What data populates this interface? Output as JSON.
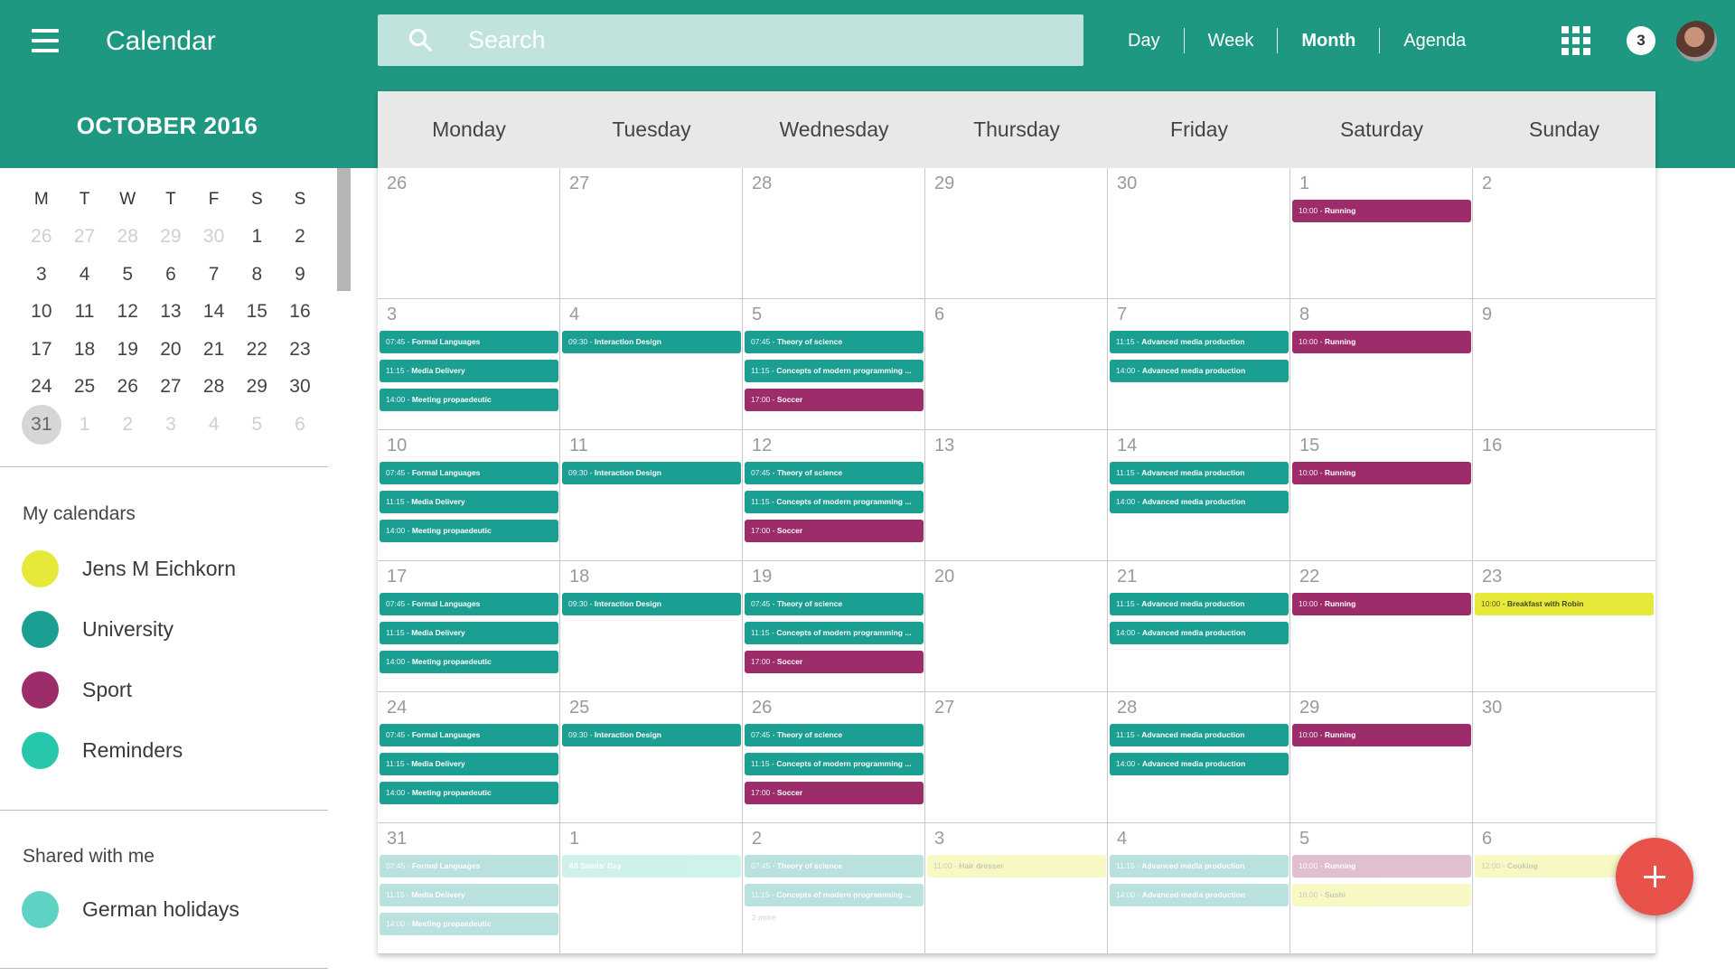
{
  "header": {
    "title": "Calendar",
    "search_placeholder": "Search",
    "views": [
      {
        "label": "Day",
        "active": false
      },
      {
        "label": "Week",
        "active": false
      },
      {
        "label": "Month",
        "active": true
      },
      {
        "label": "Agenda",
        "active": false
      }
    ],
    "notification_count": "3"
  },
  "colors": {
    "primary": "#1f9882",
    "university": "#1a9f92",
    "sport": "#9c2d6a",
    "reminders": "#27c7ab",
    "german_holidays": "#5fd3c3",
    "personal": "#e6e93a",
    "fab": "#e9524b"
  },
  "sidebar": {
    "month_label": "OCTOBER 2016",
    "mini_calendar": {
      "weekdays": [
        "M",
        "T",
        "W",
        "T",
        "F",
        "S",
        "S"
      ],
      "weeks": [
        [
          {
            "d": "26",
            "m": true
          },
          {
            "d": "27",
            "m": true
          },
          {
            "d": "28",
            "m": true
          },
          {
            "d": "29",
            "m": true
          },
          {
            "d": "30",
            "m": true
          },
          {
            "d": "1"
          },
          {
            "d": "2"
          }
        ],
        [
          {
            "d": "3"
          },
          {
            "d": "4"
          },
          {
            "d": "5"
          },
          {
            "d": "6"
          },
          {
            "d": "7"
          },
          {
            "d": "8"
          },
          {
            "d": "9"
          }
        ],
        [
          {
            "d": "10"
          },
          {
            "d": "11"
          },
          {
            "d": "12"
          },
          {
            "d": "13"
          },
          {
            "d": "14"
          },
          {
            "d": "15"
          },
          {
            "d": "16"
          }
        ],
        [
          {
            "d": "17"
          },
          {
            "d": "18"
          },
          {
            "d": "19"
          },
          {
            "d": "20"
          },
          {
            "d": "21"
          },
          {
            "d": "22"
          },
          {
            "d": "23"
          }
        ],
        [
          {
            "d": "24"
          },
          {
            "d": "25"
          },
          {
            "d": "26"
          },
          {
            "d": "27"
          },
          {
            "d": "28"
          },
          {
            "d": "29"
          },
          {
            "d": "30"
          }
        ],
        [
          {
            "d": "31",
            "today": true
          },
          {
            "d": "1",
            "m": true
          },
          {
            "d": "2",
            "m": true
          },
          {
            "d": "3",
            "m": true
          },
          {
            "d": "4",
            "m": true
          },
          {
            "d": "5",
            "m": true
          },
          {
            "d": "6",
            "m": true
          }
        ]
      ]
    },
    "my_calendars_title": "My calendars",
    "my_calendars": [
      {
        "label": "Jens M Eichkorn",
        "color": "#e6e93a"
      },
      {
        "label": "University",
        "color": "#1a9f92"
      },
      {
        "label": "Sport",
        "color": "#9c2d6a"
      },
      {
        "label": "Reminders",
        "color": "#27c7ab"
      }
    ],
    "shared_title": "Shared with me",
    "shared_calendars": [
      {
        "label": "German holidays",
        "color": "#5fd3c3"
      }
    ]
  },
  "month_view": {
    "weekdays": [
      "Monday",
      "Tuesday",
      "Wednesday",
      "Thursday",
      "Friday",
      "Saturday",
      "Sunday"
    ],
    "weeks": [
      [
        {
          "num": "26",
          "events": []
        },
        {
          "num": "27",
          "events": []
        },
        {
          "num": "28",
          "events": []
        },
        {
          "num": "29",
          "events": []
        },
        {
          "num": "30",
          "events": []
        },
        {
          "num": "1",
          "events": [
            {
              "time": "10:00",
              "name": "Running",
              "cal": "sport"
            }
          ]
        },
        {
          "num": "2",
          "events": []
        }
      ],
      [
        {
          "num": "3",
          "events": [
            {
              "time": "07:45",
              "name": "Formal Languages",
              "cal": "university"
            },
            {
              "time": "11:15",
              "name": "Media Delivery",
              "cal": "university"
            },
            {
              "time": "14:00",
              "name": "Meeting propaedeutic",
              "cal": "university"
            }
          ]
        },
        {
          "num": "4",
          "events": [
            {
              "time": "09:30",
              "name": "Interaction Design",
              "cal": "university"
            }
          ]
        },
        {
          "num": "5",
          "events": [
            {
              "time": "07:45",
              "name": "Theory of science",
              "cal": "university"
            },
            {
              "time": "11:15",
              "name": "Concepts of modern programming ...",
              "cal": "university"
            },
            {
              "time": "17:00",
              "name": "Soccer",
              "cal": "sport"
            }
          ]
        },
        {
          "num": "6",
          "events": []
        },
        {
          "num": "7",
          "events": [
            {
              "time": "11:15",
              "name": "Advanced media production",
              "cal": "university"
            },
            {
              "time": "14:00",
              "name": "Advanced media production",
              "cal": "university"
            }
          ]
        },
        {
          "num": "8",
          "events": [
            {
              "time": "10:00",
              "name": "Running",
              "cal": "sport"
            }
          ]
        },
        {
          "num": "9",
          "events": []
        }
      ],
      [
        {
          "num": "10",
          "events": [
            {
              "time": "07:45",
              "name": "Formal Languages",
              "cal": "university"
            },
            {
              "time": "11:15",
              "name": "Media Delivery",
              "cal": "university"
            },
            {
              "time": "14:00",
              "name": "Meeting propaedeutic",
              "cal": "university"
            }
          ]
        },
        {
          "num": "11",
          "events": [
            {
              "time": "09:30",
              "name": "Interaction Design",
              "cal": "university"
            }
          ]
        },
        {
          "num": "12",
          "events": [
            {
              "time": "07:45",
              "name": "Theory of science",
              "cal": "university"
            },
            {
              "time": "11:15",
              "name": "Concepts of modern programming ...",
              "cal": "university"
            },
            {
              "time": "17:00",
              "name": "Soccer",
              "cal": "sport"
            }
          ]
        },
        {
          "num": "13",
          "events": []
        },
        {
          "num": "14",
          "events": [
            {
              "time": "11:15",
              "name": "Advanced media production",
              "cal": "university"
            },
            {
              "time": "14:00",
              "name": "Advanced media production",
              "cal": "university"
            }
          ]
        },
        {
          "num": "15",
          "events": [
            {
              "time": "10:00",
              "name": "Running",
              "cal": "sport"
            }
          ]
        },
        {
          "num": "16",
          "events": []
        }
      ],
      [
        {
          "num": "17",
          "events": [
            {
              "time": "07:45",
              "name": "Formal Languages",
              "cal": "university"
            },
            {
              "time": "11:15",
              "name": "Media Delivery",
              "cal": "university"
            },
            {
              "time": "14:00",
              "name": "Meeting propaedeutic",
              "cal": "university"
            }
          ]
        },
        {
          "num": "18",
          "events": [
            {
              "time": "09:30",
              "name": "Interaction Design",
              "cal": "university"
            }
          ]
        },
        {
          "num": "19",
          "events": [
            {
              "time": "07:45",
              "name": "Theory of science",
              "cal": "university"
            },
            {
              "time": "11:15",
              "name": "Concepts of modern programming ...",
              "cal": "university"
            },
            {
              "time": "17:00",
              "name": "Soccer",
              "cal": "sport"
            }
          ]
        },
        {
          "num": "20",
          "events": []
        },
        {
          "num": "21",
          "events": [
            {
              "time": "11:15",
              "name": "Advanced media production",
              "cal": "university"
            },
            {
              "time": "14:00",
              "name": "Advanced media production",
              "cal": "university"
            }
          ]
        },
        {
          "num": "22",
          "events": [
            {
              "time": "10:00",
              "name": "Running",
              "cal": "sport"
            }
          ]
        },
        {
          "num": "23",
          "events": [
            {
              "time": "10:00",
              "name": "Breakfast with Robin",
              "cal": "personal"
            }
          ]
        }
      ],
      [
        {
          "num": "24",
          "events": [
            {
              "time": "07:45",
              "name": "Formal Languages",
              "cal": "university"
            },
            {
              "time": "11:15",
              "name": "Media Delivery",
              "cal": "university"
            },
            {
              "time": "14:00",
              "name": "Meeting propaedeutic",
              "cal": "university"
            }
          ]
        },
        {
          "num": "25",
          "events": [
            {
              "time": "09:30",
              "name": "Interaction Design",
              "cal": "university"
            }
          ]
        },
        {
          "num": "26",
          "events": [
            {
              "time": "07:45",
              "name": "Theory of science",
              "cal": "university"
            },
            {
              "time": "11:15",
              "name": "Concepts of modern programming ...",
              "cal": "university"
            },
            {
              "time": "17:00",
              "name": "Soccer",
              "cal": "sport"
            }
          ]
        },
        {
          "num": "27",
          "events": []
        },
        {
          "num": "28",
          "events": [
            {
              "time": "11:15",
              "name": "Advanced media production",
              "cal": "university"
            },
            {
              "time": "14:00",
              "name": "Advanced media production",
              "cal": "university"
            }
          ]
        },
        {
          "num": "29",
          "events": [
            {
              "time": "10:00",
              "name": "Running",
              "cal": "sport"
            }
          ]
        },
        {
          "num": "30",
          "events": []
        }
      ],
      [
        {
          "num": "31",
          "events": [
            {
              "time": "07:45",
              "name": "Formal Languages",
              "cal": "university"
            },
            {
              "time": "11:15",
              "name": "Media Delivery",
              "cal": "university"
            },
            {
              "time": "14:00",
              "name": "Meeting propaedeutic",
              "cal": "university"
            }
          ]
        },
        {
          "num": "1",
          "events": [
            {
              "time": "",
              "name": "All Saints' Day",
              "cal": "german_holidays"
            }
          ]
        },
        {
          "num": "2",
          "events": [
            {
              "time": "07:45",
              "name": "Theory of science",
              "cal": "university"
            },
            {
              "time": "11:15",
              "name": "Concepts of modern programming ...",
              "cal": "university"
            }
          ],
          "more": "2 more"
        },
        {
          "num": "3",
          "events": [
            {
              "time": "11:00",
              "name": "Hair dresser",
              "cal": "personal"
            }
          ]
        },
        {
          "num": "4",
          "events": [
            {
              "time": "11:15",
              "name": "Advanced media production",
              "cal": "university"
            },
            {
              "time": "14:00",
              "name": "Advanced media production",
              "cal": "university"
            }
          ]
        },
        {
          "num": "5",
          "events": [
            {
              "time": "10:00",
              "name": "Running",
              "cal": "sport"
            },
            {
              "time": "18:00",
              "name": "Sushi",
              "cal": "personal"
            }
          ]
        },
        {
          "num": "6",
          "events": [
            {
              "time": "12:00",
              "name": "Cooking",
              "cal": "personal"
            }
          ]
        }
      ]
    ]
  }
}
